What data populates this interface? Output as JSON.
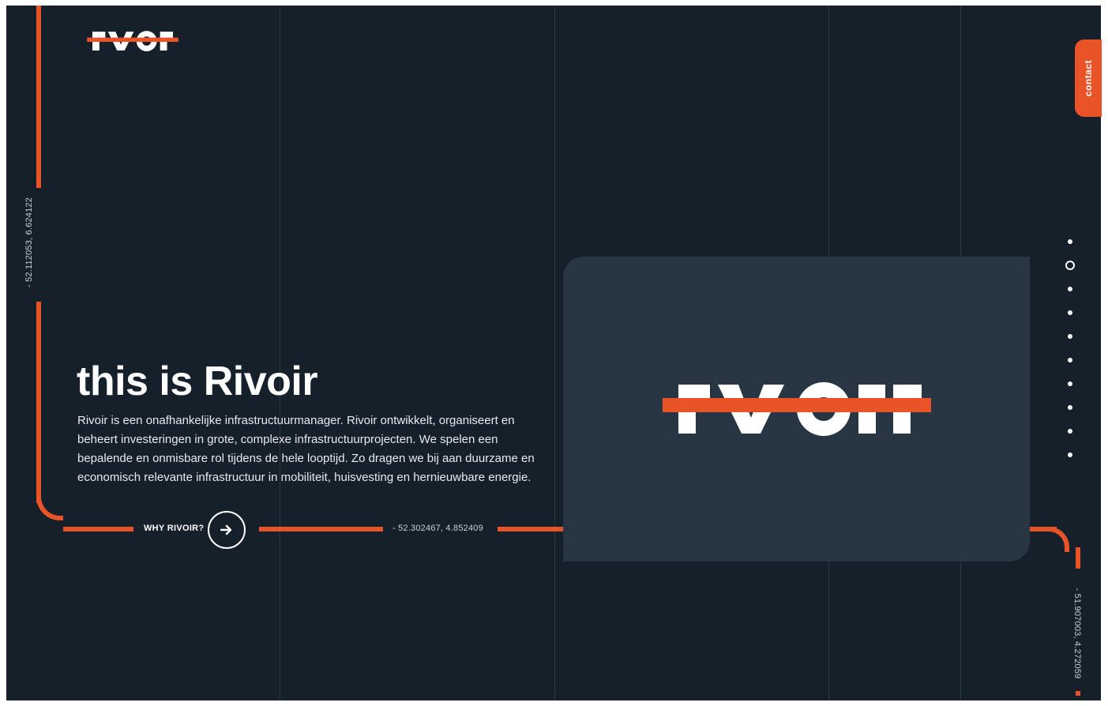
{
  "header": {
    "logo_text": "rivoir"
  },
  "contact_tab": {
    "label": "contact"
  },
  "coordinates": {
    "left_vertical": "- 52.112053, 6.624122",
    "horizontal": "- 52.302467, 4.852409",
    "right_vertical": "- 51.907003, 4.272059"
  },
  "hero": {
    "title": "this is Rivoir",
    "body": "Rivoir is een onafhankelijke infrastructuurmanager. Rivoir ontwikkelt, organiseert en beheert investeringen in grote, complexe infrastructuurprojecten. We spelen een bepalende en onmisbare rol tijdens de hele looptijd. Zo dragen we bij aan duurzame en economisch relevante infrastructuur in mobiliteit, huisvesting en hernieuwbare energie.",
    "cta_label": "WHY RIVOIR?",
    "cta_icon": "arrow-right-icon"
  },
  "brand_card": {
    "logo_text": "rivoir"
  },
  "pagination": {
    "total": 10,
    "active_index": 1
  },
  "colors": {
    "background": "#16202b",
    "accent": "#e85427",
    "card": "#283643",
    "text": "#ffffff"
  }
}
